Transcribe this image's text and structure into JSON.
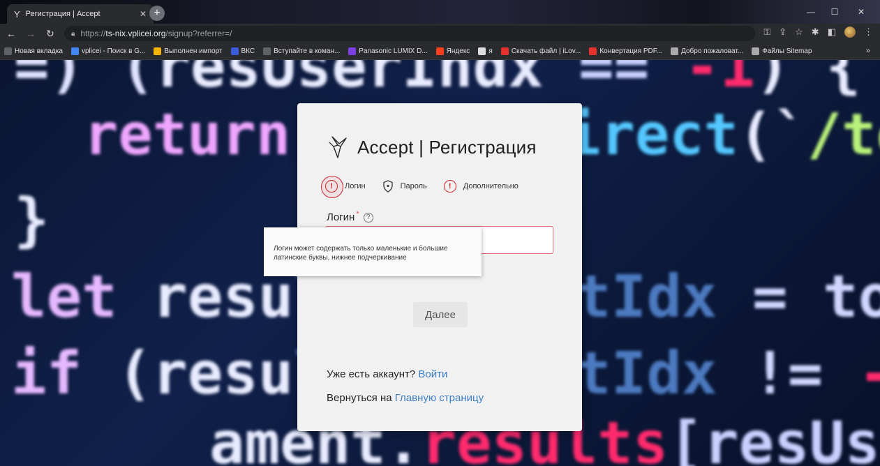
{
  "browser": {
    "tab_title": "Регистрация | Accept",
    "tab_close": "✕",
    "new_tab": "+",
    "url_host": "ts-nix.vplicei.org",
    "url_prefix": "https://",
    "url_path": "/signup?referrer=/",
    "bookmarks": [
      {
        "label": "Новая вкладка",
        "color": "#5f6368"
      },
      {
        "label": "vplicei - Поиск в G...",
        "color": "#4285f4"
      },
      {
        "label": "Выполнен импорт",
        "color": "#f4b400"
      },
      {
        "label": "ВКС",
        "color": "#3b5bdb"
      },
      {
        "label": "Вступайте в коман...",
        "color": "#5f6368"
      },
      {
        "label": "Panasonic LUMIX D...",
        "color": "#7b3fe4"
      },
      {
        "label": "Яндекс",
        "color": "#fc3f1d"
      },
      {
        "label": "я",
        "color": "#dddddd"
      },
      {
        "label": "Скачать файл | iLov...",
        "color": "#e5322d"
      },
      {
        "label": "Конвертация PDF...",
        "color": "#e5322d"
      },
      {
        "label": "Добро пожаловат...",
        "color": "#aaaaaa"
      },
      {
        "label": "Файлы Sitemap",
        "color": "#aaaaaa"
      }
    ],
    "bookmarks_more": "»"
  },
  "card": {
    "brand_title": "Accept | Регистрация",
    "steps": [
      {
        "label": "Логин",
        "state": "error-active"
      },
      {
        "label": "Пароль",
        "state": "pending"
      },
      {
        "label": "Дополнительно",
        "state": "error"
      }
    ],
    "login_label": "Логин",
    "required_mark": "*",
    "help_mark": "?",
    "login_value": "",
    "next_label": "Далее",
    "have_account_text": "Уже есть аккаунт?",
    "login_link": "Войти",
    "back_text": "Вернуться на",
    "home_link": "Главную страницу"
  },
  "tooltip": {
    "text": "Логин может содержать только маленькие и большие латинские буквы, нижнее подчеркивание"
  },
  "colors": {
    "accent_link": "#3f7fc4",
    "error": "#d0252e"
  }
}
